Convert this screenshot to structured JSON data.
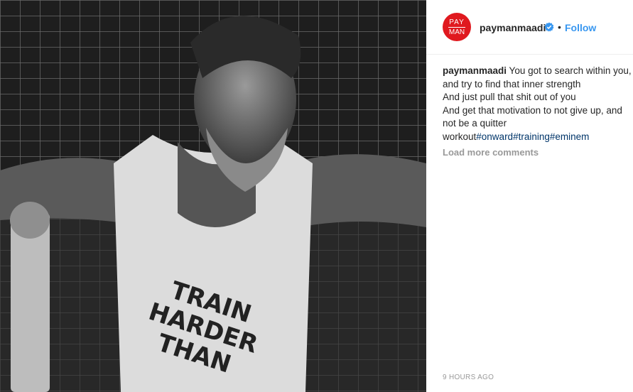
{
  "post": {
    "image_alt": "",
    "shirt_text": [
      "TRAIN",
      "HARDER",
      "THAN"
    ]
  },
  "header": {
    "avatar_line1": "PAY",
    "avatar_line2": "MAN",
    "username": "paymanmaadi",
    "separator": "•",
    "follow_label": "Follow"
  },
  "caption": {
    "username": "paymanmaadi",
    "text": " You got to search within you, and try to find that inner strength\nAnd just pull that shit out of you\nAnd get that motivation to not give up, and not be a quitter\nworkout",
    "hashtags": [
      "#onward",
      "#training",
      "#eminem"
    ]
  },
  "comments": {
    "load_more_label": "Load more comments"
  },
  "footer": {
    "timestamp": "9 HOURS AGO"
  },
  "colors": {
    "accent": "#3897f0",
    "hashtag": "#003569",
    "avatar": "#e0191f"
  }
}
